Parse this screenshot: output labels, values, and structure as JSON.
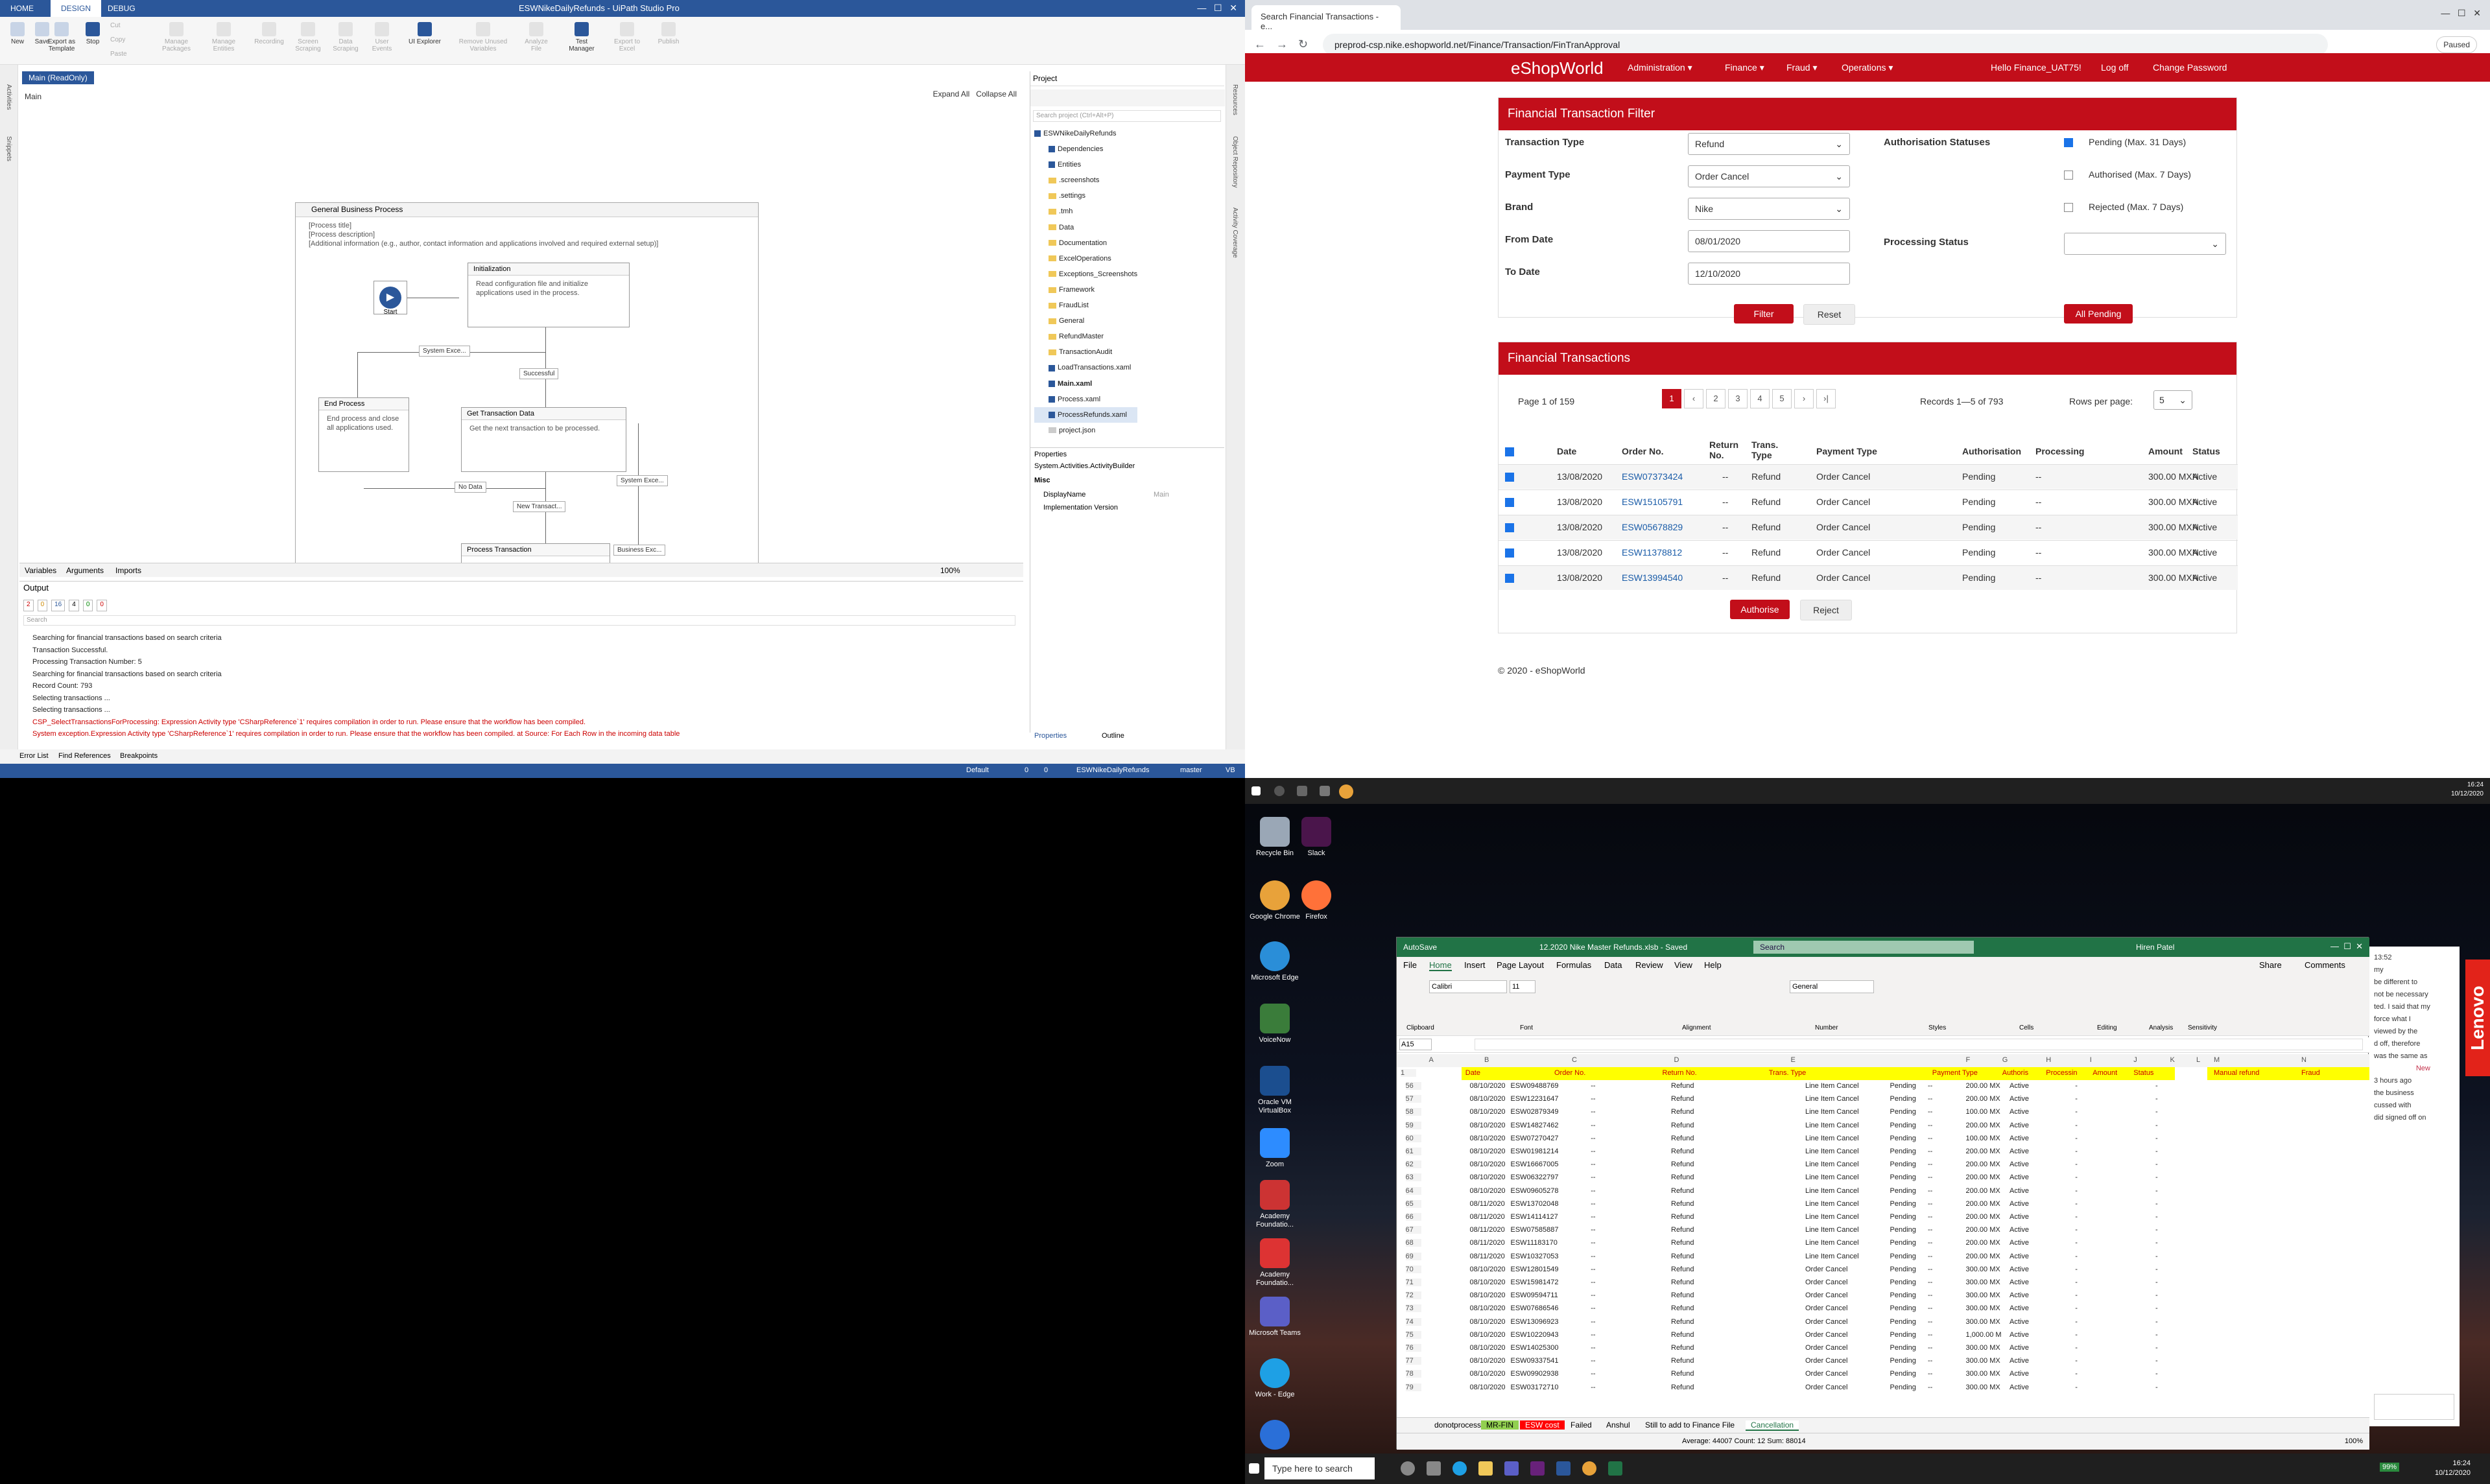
{
  "uipath": {
    "title": "ESWNikeDailyRefunds - UiPath Studio Pro",
    "tabs": [
      "HOME",
      "DESIGN",
      "DEBUG"
    ],
    "ribbon": [
      "New",
      "Save",
      "Export as Template",
      "Stop",
      "Cut",
      "Copy",
      "Paste",
      "Manage Packages",
      "Manage Entities",
      "Recording",
      "Screen Scraping",
      "Data Scraping",
      "User Events",
      "UI Explorer",
      "Remove Unused Variables",
      "Analyze File",
      "Test Manager",
      "Export to Excel",
      "Publish"
    ],
    "doc_tab": "Main (ReadOnly)",
    "breadcrumb": "Main",
    "expand_all": "Expand All",
    "collapse_all": "Collapse All",
    "gbp_title": "General Business Process",
    "gbp_desc": [
      "[Process title]",
      "[Process description]",
      "[Additional information (e.g., author, contact information and applications involved and required external setup)]"
    ],
    "start_label": "Start",
    "init": {
      "title": "Initialization",
      "body": "Read configuration file and initialize applications used in the process."
    },
    "end": {
      "title": "End Process",
      "body": "End process and close all applications used."
    },
    "get": {
      "title": "Get Transaction Data",
      "body": "Get the next transaction to be processed."
    },
    "process": {
      "title": "Process Transaction"
    },
    "labels": {
      "sysexc1": "System Exce...",
      "successful": "Successful",
      "nodata": "No Data",
      "newtrans": "New Transact...",
      "sysexc2": "System Exce...",
      "busexc": "Business Exc..."
    },
    "bottom_tabs": [
      "Variables",
      "Arguments",
      "Imports"
    ],
    "zoom": "100%",
    "output_title": "Output",
    "output_filters": [
      "2",
      "0",
      "16",
      "4",
      "0",
      "0"
    ],
    "output_search": "Search",
    "log": [
      "Searching for financial transactions based on search criteria",
      "Transaction Successful.",
      "Processing Transaction Number: 5",
      "Searching for financial transactions based on search criteria",
      "Record Count: 793",
      "Selecting transactions ...",
      "Selecting transactions ..."
    ],
    "log_err": [
      "CSP_SelectTransactionsForProcessing: Expression Activity type 'CSharpReference`1' requires compilation in order to run.  Please ensure that the workflow has been compiled.",
      "System exception.Expression Activity type 'CSharpReference`1' requires compilation in order to run.  Please ensure that the workflow has been compiled. at Source: For Each Row in the incoming data table"
    ],
    "project_title": "Project",
    "project_search": "Search project (Ctrl+Alt+P)",
    "tree": [
      "ESWNikeDailyRefunds",
      "Dependencies",
      "Entities",
      ".screenshots",
      ".settings",
      ".tmh",
      "Data",
      "Documentation",
      "ExcelOperations",
      "Exceptions_Screenshots",
      "Framework",
      "FraudList",
      "General",
      "RefundMaster",
      "TransactionAudit",
      "LoadTransactions.xaml",
      "Main.xaml",
      "Process.xaml",
      "ProcessRefunds.xaml",
      "project.json"
    ],
    "props_title": "Properties",
    "props_type": "System.Activities.ActivityBuilder",
    "props_misc": "Misc",
    "props_rows": [
      "DisplayName",
      "Implementation Version"
    ],
    "props_main": "Main",
    "props_tabs": [
      "Properties",
      "Outline"
    ],
    "bottom_links": [
      "Error List",
      "Find References",
      "Breakpoints"
    ],
    "status": [
      "Default",
      "0",
      "0",
      "ESWNikeDailyRefunds",
      "master",
      "VB"
    ],
    "side_left": [
      "Activities",
      "Snippets"
    ],
    "side_right": [
      "Resources",
      "Object Repository",
      "Activity Coverage"
    ]
  },
  "chrome": {
    "tab_title": "Search Financial Transactions - e...",
    "url": "preprod-csp.nike.eshopworld.net/Finance/Transaction/FinTranApproval",
    "paused": "Paused",
    "logo": "eShopWorld",
    "menu": [
      "Administration ▾",
      "Finance ▾",
      "Fraud ▾",
      "Operations ▾"
    ],
    "user": [
      "Hello Finance_UAT75!",
      "Log off",
      "Change Password"
    ],
    "filter": {
      "title": "Financial Transaction Filter",
      "labels": [
        "Transaction Type",
        "Payment Type",
        "Brand",
        "From Date",
        "To Date",
        "Authorisation Statuses",
        "Processing Status"
      ],
      "values": [
        "Refund",
        "Order Cancel",
        "Nike",
        "08/01/2020",
        "12/10/2020"
      ],
      "statuses": [
        "Pending (Max. 31 Days)",
        "Authorised (Max. 7 Days)",
        "Rejected (Max. 7 Days)"
      ],
      "filter_btn": "Filter",
      "reset_btn": "Reset",
      "all_pending_btn": "All Pending"
    },
    "results": {
      "title": "Financial Transactions",
      "page_info": "Page 1 of 159",
      "pages": [
        "|‹",
        "‹",
        "1",
        "2",
        "3",
        "4",
        "5",
        "›",
        "›|"
      ],
      "records": "Records 1—5 of 793",
      "rows_per_page_label": "Rows per page:",
      "rows_per_page": "5",
      "headers": [
        "Date",
        "Order No.",
        "Return No.",
        "Trans. Type",
        "Payment Type",
        "Authorisation",
        "Processing",
        "Amount",
        "Status"
      ],
      "rows": [
        [
          "13/08/2020",
          "ESW07373424",
          "--",
          "Refund",
          "Order Cancel",
          "Pending",
          "--",
          "300.00 MXN",
          "Active"
        ],
        [
          "13/08/2020",
          "ESW15105791",
          "--",
          "Refund",
          "Order Cancel",
          "Pending",
          "--",
          "300.00 MXN",
          "Active"
        ],
        [
          "13/08/2020",
          "ESW05678829",
          "--",
          "Refund",
          "Order Cancel",
          "Pending",
          "--",
          "300.00 MXN",
          "Active"
        ],
        [
          "13/08/2020",
          "ESW11378812",
          "--",
          "Refund",
          "Order Cancel",
          "Pending",
          "--",
          "300.00 MXN",
          "Active"
        ],
        [
          "13/08/2020",
          "ESW13994540",
          "--",
          "Refund",
          "Order Cancel",
          "Pending",
          "--",
          "300.00 MXN",
          "Active"
        ]
      ],
      "authorise_btn": "Authorise",
      "reject_btn": "Reject"
    },
    "footer": "© 2020 - eShopWorld"
  },
  "desktop": {
    "clock_top": [
      "16:24",
      "10/12/2020"
    ],
    "icons": [
      "Recycle Bin",
      "Slack",
      "Google Chrome",
      "Firefox",
      "Microsoft Edge",
      "VoiceNow",
      "Oracle VM VirtualBox",
      "Zoom",
      "Academy Foundatio...",
      "Academy Foundatio...",
      "Microsoft Teams",
      "Work - Edge"
    ],
    "excel": {
      "title": "12.2020 Nike Master Refunds.xlsb - Saved",
      "search": "Search",
      "user": "Hiren Patel",
      "autosave": "AutoSave",
      "tabs": [
        "File",
        "Home",
        "Insert",
        "Page Layout",
        "Formulas",
        "Data",
        "Review",
        "View",
        "Help"
      ],
      "share": "Share",
      "comments": "Comments",
      "groups": [
        "Clipboard",
        "Font",
        "Alignment",
        "Number",
        "Styles",
        "Cells",
        "Editing",
        "Analysis",
        "Sensitivity"
      ],
      "font": "Calibri",
      "size": "11",
      "numfmt": "General",
      "cellref": "A15",
      "cols": [
        "A",
        "B",
        "C",
        "D",
        "E",
        "F",
        "G",
        "H",
        "I",
        "J",
        "K",
        "L",
        "M",
        "N"
      ],
      "headers": [
        "Date",
        "Order No.",
        "Return No.",
        "Trans. Type",
        "Payment Type",
        "Authoris",
        "Processin",
        "Amount",
        "Status",
        "Manual refund",
        "Fraud"
      ],
      "rows": [
        [
          "56",
          "08/10/2020",
          "ESW09488769",
          "Line Item Cancel",
          "200.00 MX"
        ],
        [
          "57",
          "08/10/2020",
          "ESW12231647",
          "Line Item Cancel",
          "200.00 MX"
        ],
        [
          "58",
          "08/10/2020",
          "ESW02879349",
          "Line Item Cancel",
          "100.00 MX"
        ],
        [
          "59",
          "08/10/2020",
          "ESW14827462",
          "Line Item Cancel",
          "200.00 MX"
        ],
        [
          "60",
          "08/10/2020",
          "ESW07270427",
          "Line Item Cancel",
          "100.00 MX"
        ],
        [
          "61",
          "08/10/2020",
          "ESW01981214",
          "Line Item Cancel",
          "200.00 MX"
        ],
        [
          "62",
          "08/10/2020",
          "ESW16667005",
          "Line Item Cancel",
          "200.00 MX"
        ],
        [
          "63",
          "08/10/2020",
          "ESW06322797",
          "Line Item Cancel",
          "200.00 MX"
        ],
        [
          "64",
          "08/10/2020",
          "ESW09605278",
          "Line Item Cancel",
          "200.00 MX"
        ],
        [
          "65",
          "08/11/2020",
          "ESW13702048",
          "Line Item Cancel",
          "200.00 MX"
        ],
        [
          "66",
          "08/11/2020",
          "ESW14114127",
          "Line Item Cancel",
          "200.00 MX"
        ],
        [
          "67",
          "08/11/2020",
          "ESW07585887",
          "Line Item Cancel",
          "200.00 MX"
        ],
        [
          "68",
          "08/11/2020",
          "ESW11183170",
          "Line Item Cancel",
          "200.00 MX"
        ],
        [
          "69",
          "08/11/2020",
          "ESW10327053",
          "Line Item Cancel",
          "200.00 MX"
        ],
        [
          "70",
          "08/10/2020",
          "ESW12801549",
          "Order Cancel",
          "300.00 MX"
        ],
        [
          "71",
          "08/10/2020",
          "ESW15981472",
          "Order Cancel",
          "300.00 MX"
        ],
        [
          "72",
          "08/10/2020",
          "ESW09594711",
          "Order Cancel",
          "300.00 MX"
        ],
        [
          "73",
          "08/10/2020",
          "ESW07686546",
          "Order Cancel",
          "300.00 MX"
        ],
        [
          "74",
          "08/10/2020",
          "ESW13096923",
          "Order Cancel",
          "300.00 MX"
        ],
        [
          "75",
          "08/10/2020",
          "ESW10220943",
          "Order Cancel",
          "1,000.00 M"
        ],
        [
          "76",
          "08/10/2020",
          "ESW14025300",
          "Order Cancel",
          "300.00 MX"
        ],
        [
          "77",
          "08/10/2020",
          "ESW09337541",
          "Order Cancel",
          "300.00 MX"
        ],
        [
          "78",
          "08/10/2020",
          "ESW09902938",
          "Order Cancel",
          "300.00 MX"
        ],
        [
          "79",
          "08/10/2020",
          "ESW03172710",
          "Order Cancel",
          "300.00 MX"
        ]
      ],
      "row_const": {
        "ret": "--",
        "type": "Refund",
        "auth": "Pending",
        "proc": "--",
        "status": "Active",
        "dash": "-"
      },
      "sheets": [
        "donotprocess",
        "MR-FIN",
        "ESW cost",
        "Failed",
        "Anshul",
        "Still to add to Finance File",
        "Cancellation"
      ],
      "status": "Average: 44007    Count: 12    Sum: 88014",
      "zoom": "100%"
    },
    "teams_text": [
      "13:52",
      "my",
      "be different to",
      "not be necessary",
      "ted. I said that my",
      "force what I",
      "viewed by the",
      "d off, therefore",
      "was the same as",
      "New",
      "3 hours ago",
      "the business",
      "cussed with",
      "did signed off on"
    ],
    "taskbar_search": "Type here to search",
    "clock": [
      "16:24",
      "10/12/2020"
    ],
    "battery": "99%"
  }
}
